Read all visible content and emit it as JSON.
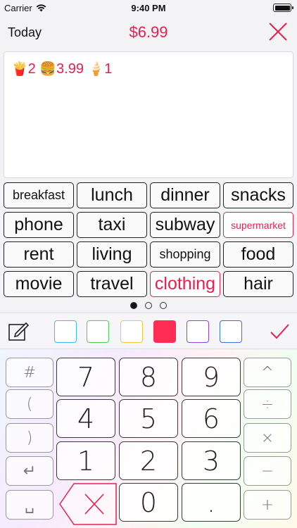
{
  "status": {
    "carrier": "Carrier",
    "time": "9:40 PM"
  },
  "nav": {
    "left": "Today",
    "total": "$6.99"
  },
  "note": {
    "items": [
      {
        "icon": "fries-icon",
        "glyph": "🍟",
        "qty": "2"
      },
      {
        "icon": "burger-icon",
        "glyph": "🍔",
        "qty": "3.99"
      },
      {
        "icon": "ice-cream-icon",
        "glyph": "🍦",
        "qty": "1"
      }
    ]
  },
  "tags": [
    {
      "label": "breakfast",
      "size": "small"
    },
    {
      "label": "lunch"
    },
    {
      "label": "dinner"
    },
    {
      "label": "snacks"
    },
    {
      "label": "phone"
    },
    {
      "label": "taxi"
    },
    {
      "label": "subway"
    },
    {
      "label": "supermarket",
      "size": "xs",
      "selected": true
    },
    {
      "label": "rent"
    },
    {
      "label": "living"
    },
    {
      "label": "shopping",
      "size": "small"
    },
    {
      "label": "food"
    },
    {
      "label": "movie"
    },
    {
      "label": "travel"
    },
    {
      "label": "clothing",
      "selected": true
    },
    {
      "label": "hair"
    }
  ],
  "pager": {
    "pages": 3,
    "current": 0
  },
  "colors": {
    "swatches": [
      "#3bbfe8",
      "#55cc55",
      "#f5c542",
      "#ff2d55",
      "#8e44dd",
      "#3a6fd8"
    ],
    "selected_index": 3,
    "accent": "#e8204f"
  },
  "keypad": {
    "side_left": [
      "#",
      "(",
      ")",
      "↵",
      "␣"
    ],
    "digits": [
      "7",
      "8",
      "9",
      "4",
      "5",
      "6",
      "1",
      "2",
      "3",
      "0",
      "."
    ],
    "ops": [
      "^",
      "÷",
      "×",
      "−",
      "+"
    ]
  }
}
